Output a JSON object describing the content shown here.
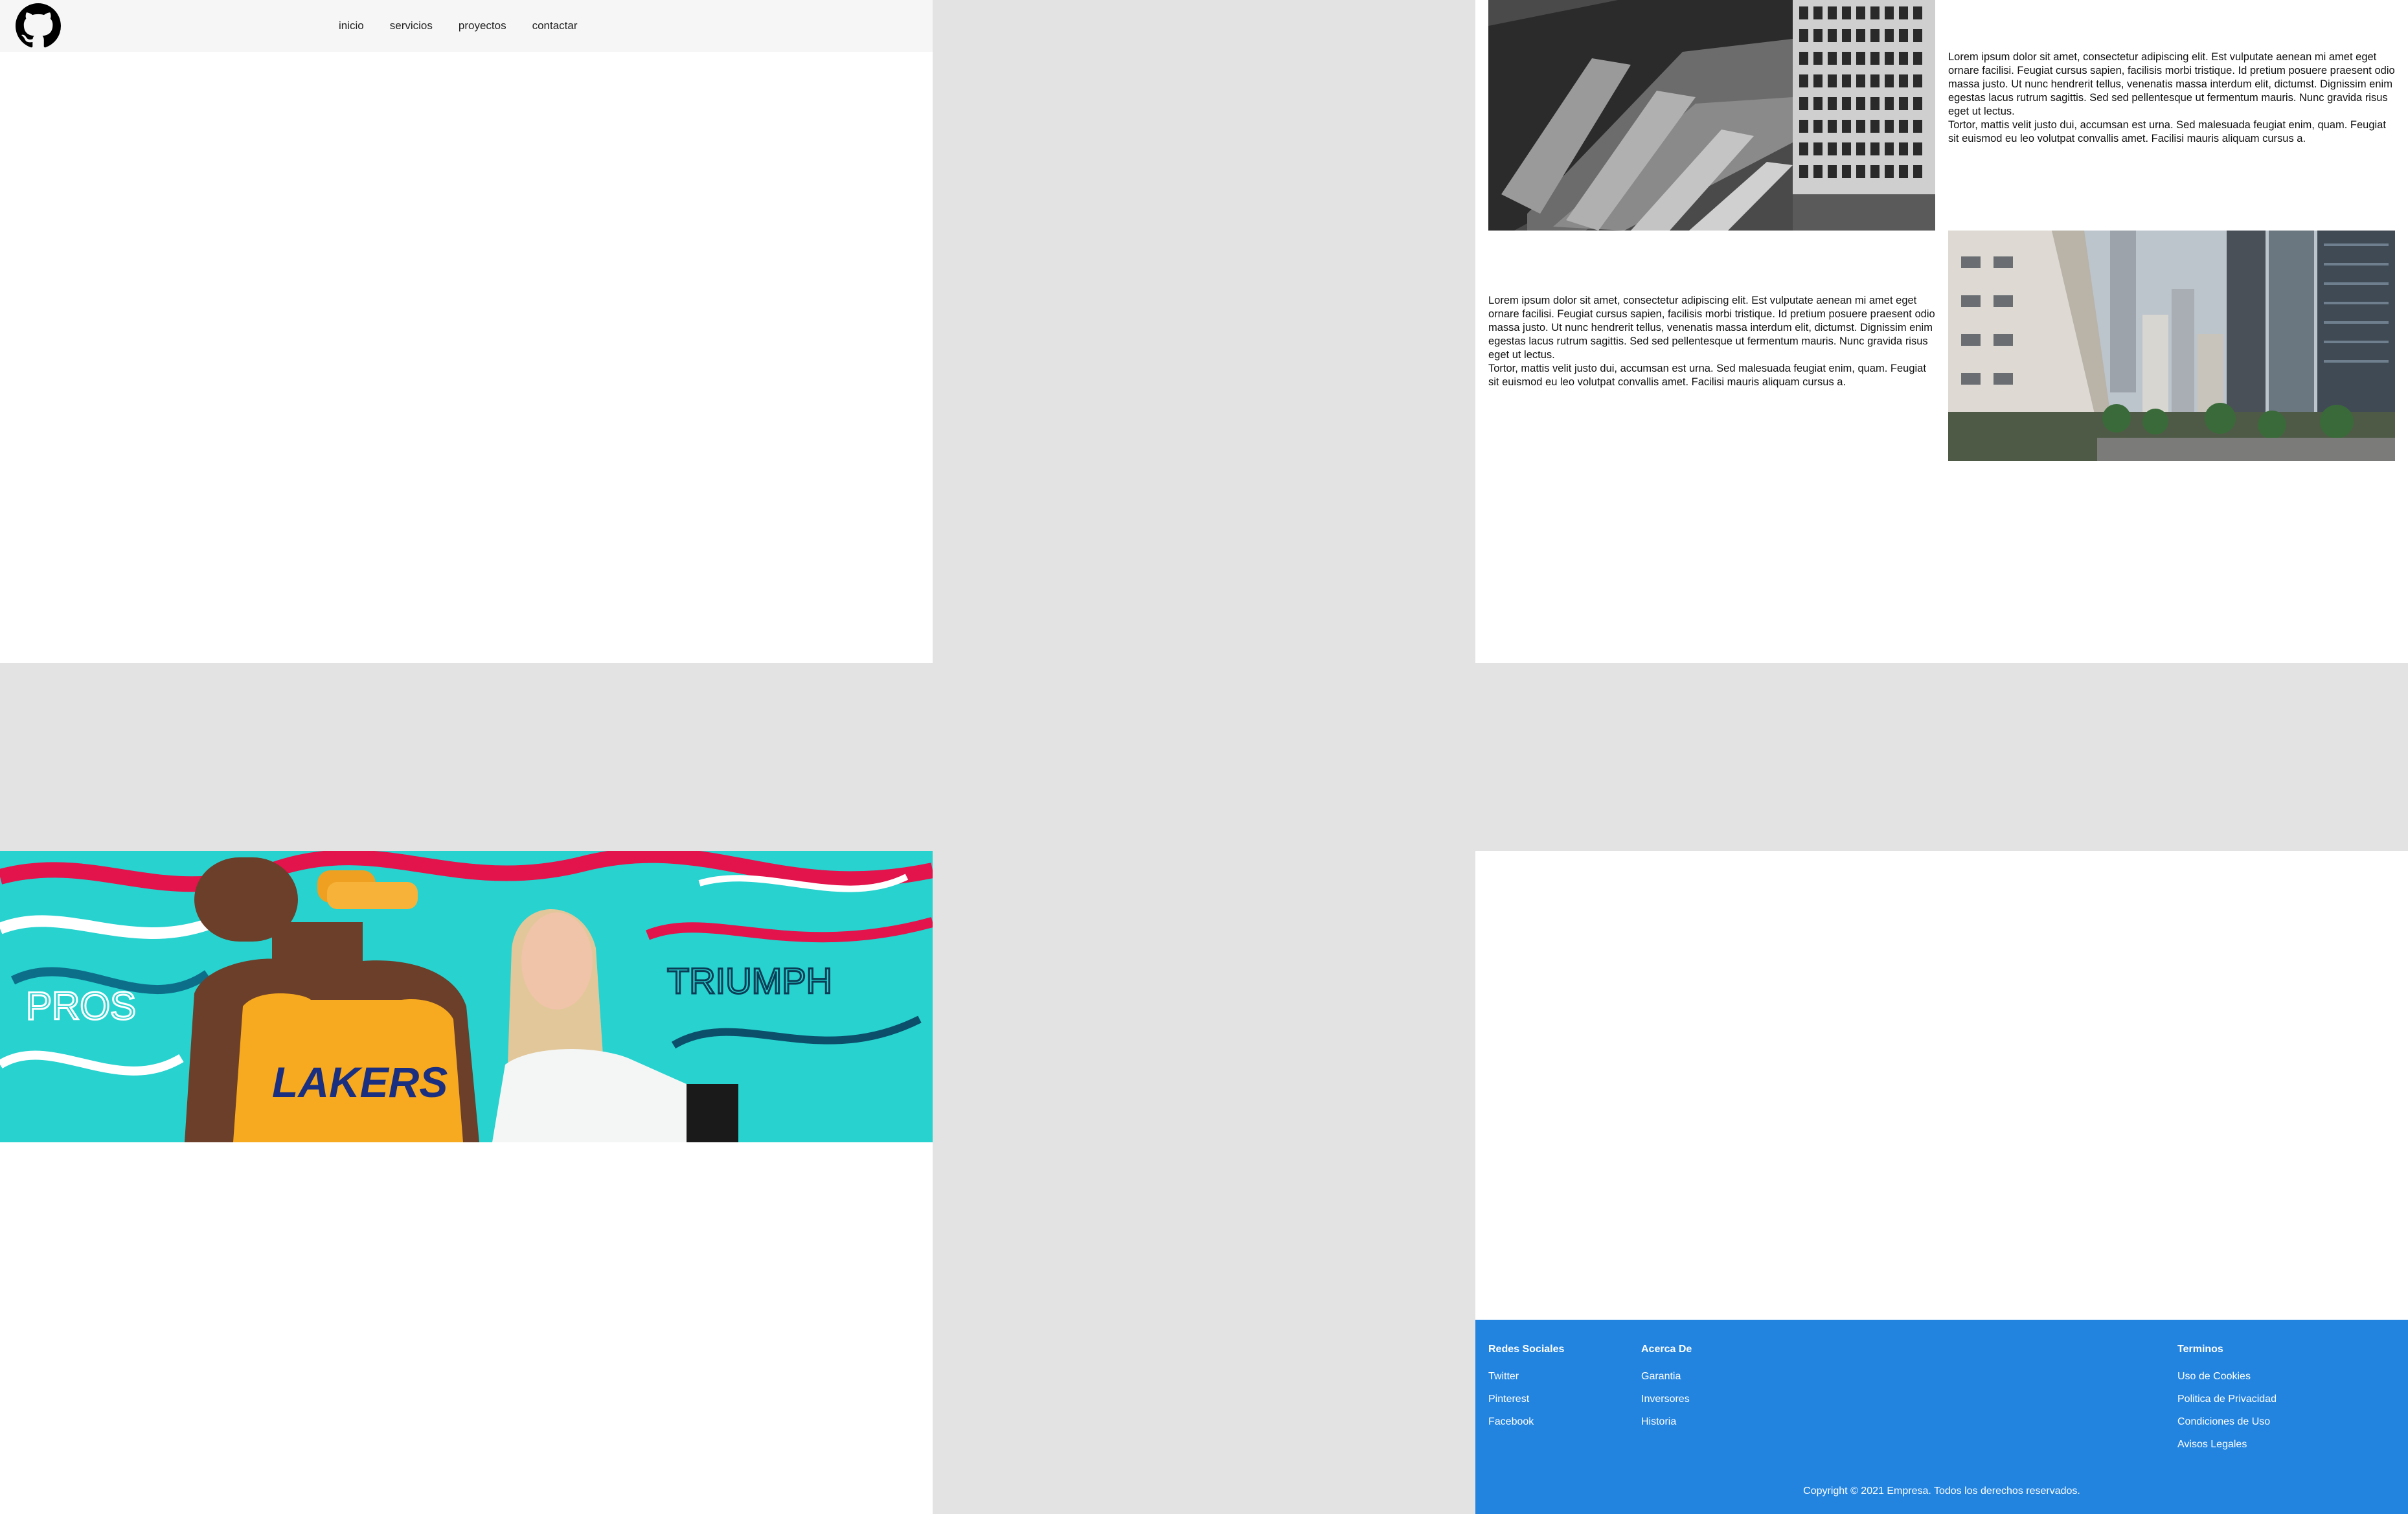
{
  "nav": {
    "logo_icon": "github-icon",
    "links": [
      {
        "label": "inicio"
      },
      {
        "label": "servicios"
      },
      {
        "label": "proyectos"
      },
      {
        "label": "contactar"
      }
    ]
  },
  "content": {
    "paragraph_1": "Lorem ipsum dolor sit amet, consectetur adipiscing elit. Est vulputate aenean mi amet eget ornare facilisi. Feugiat cursus sapien, facilisis morbi tristique. Id pretium posuere praesent odio massa justo. Ut nunc hendrerit tellus, venenatis massa interdum elit, dictumst. Dignissim enim egestas lacus rutrum sagittis. Sed sed pellentesque ut fermentum mauris. Nunc gravida risus eget ut lectus.",
    "paragraph_2": "Tortor, mattis velit justo dui, accumsan est urna. Sed malesuada feugiat enim, quam. Feugiat sit euismod eu leo volutpat convallis amet. Facilisi mauris aliquam cursus a."
  },
  "banner": {
    "jersey_text": "LAKERS",
    "graffiti_text": "TRIUMPH"
  },
  "footer": {
    "social": {
      "title": "Redes Sociales",
      "links": [
        "Twitter",
        "Pinterest",
        "Facebook"
      ]
    },
    "about": {
      "title": "Acerca De",
      "links": [
        "Garantia",
        "Inversores",
        "Historia"
      ]
    },
    "terms": {
      "title": "Terminos",
      "links": [
        "Uso de Cookies",
        "Politica de Privacidad",
        "Condiciones de Uso",
        "Avisos Legales"
      ]
    },
    "copyright": "Copyright © 2021 Empresa. Todos los derechos reservados."
  },
  "colors": {
    "background": "#e3e3e3",
    "navbar": "#f6f6f6",
    "footer": "#2384e0"
  }
}
